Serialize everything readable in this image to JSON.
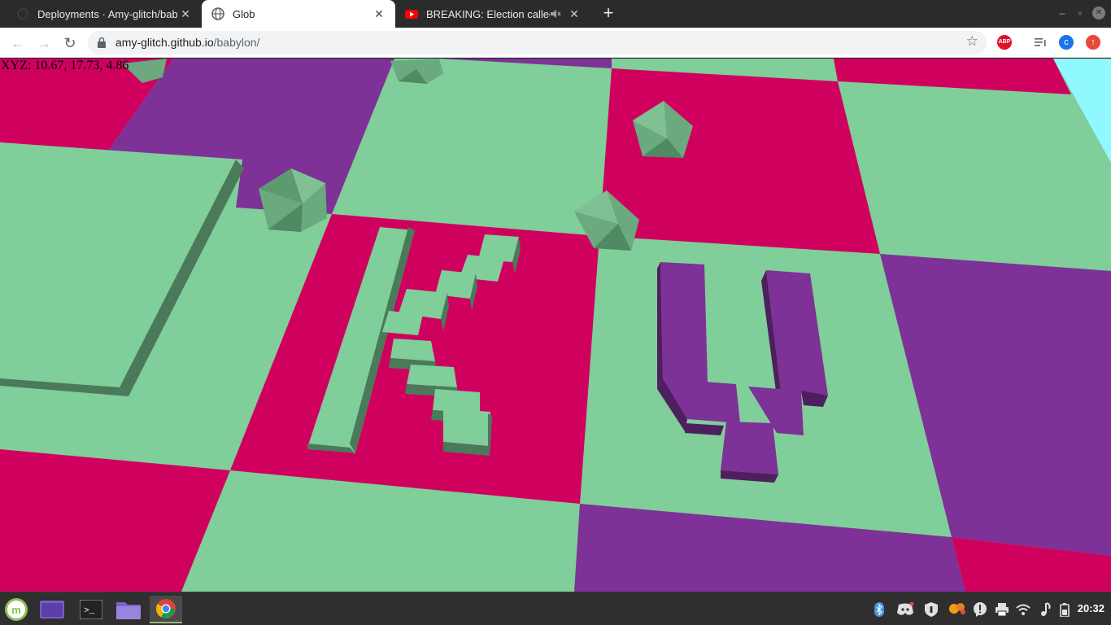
{
  "browser": {
    "tabs": [
      {
        "title": "Deployments · Amy-glitch/bab",
        "favicon": "github-icon",
        "active": false
      },
      {
        "title": "Glob",
        "favicon": "globe-icon",
        "active": true
      },
      {
        "title": "BREAKING: Election called",
        "favicon": "youtube-icon",
        "active": false,
        "muted": true
      }
    ],
    "close_glyph": "✕",
    "new_tab_glyph": "+",
    "address": {
      "host": "amy-glitch.github.io",
      "path": "/babylon/"
    },
    "extensions": [
      {
        "name": "adblock-plus-icon",
        "label": "ABP",
        "color": "#e1122b"
      },
      {
        "name": "profile-avatar",
        "label": "c",
        "color": "#1a73e8"
      },
      {
        "name": "update-icon",
        "label": "↑",
        "color": "#e8473c"
      }
    ]
  },
  "scene": {
    "coordinates": "XYZ: 10.67, 17.73, 4.86",
    "colors": {
      "green": "#80ce99",
      "pink": "#d0005f",
      "purple": "#7e3196",
      "cyan": "#8ff9ff",
      "dark_green": "#4a7a5a"
    }
  },
  "taskbar": {
    "apps": [
      {
        "name": "mint-menu-icon"
      },
      {
        "name": "workspace-icon"
      },
      {
        "name": "terminal-icon"
      },
      {
        "name": "files-icon"
      },
      {
        "name": "chrome-icon",
        "active": true
      }
    ],
    "tray": [
      "bluetooth-icon",
      "discord-icon",
      "vpn-shield-icon",
      "pinwheel-icon",
      "alert-icon",
      "printer-icon",
      "wifi-icon",
      "music-icon",
      "battery-icon"
    ],
    "clock": "20:32"
  }
}
